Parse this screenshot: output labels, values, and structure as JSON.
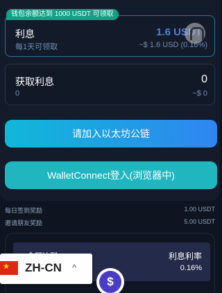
{
  "badge": "钱包余额达到 1000 USDT 可领取",
  "interest": {
    "title": "利息",
    "subtitle": "每1天可领取",
    "amount": "1.6 USDT",
    "usd_value": "~$ 1.6 USD (0.16%)"
  },
  "claim": {
    "title": "获取利息",
    "subtitle": "0",
    "amount": "0",
    "usd_value": "~$ 0"
  },
  "buttons": {
    "join_eth": "请加入以太坊公链",
    "walletconnect": "WalletConnect登入(浏览器中)"
  },
  "rewards": [
    {
      "label": "每日签到奖励",
      "value": "1.00 USDT"
    },
    {
      "label": "邀请朋友奖励",
      "value": "5.00 USDT"
    }
  ],
  "table": {
    "left_header": "金额达到",
    "right_header": "利息利率",
    "right_value": "0.16%"
  },
  "language": {
    "label": "ZH-CN",
    "chevron": "^"
  },
  "fab": {
    "symbol": "$"
  },
  "colors": {
    "accent": "#2f86f0",
    "badge": "#14a085",
    "walletconnect": "#1fb6bf"
  }
}
